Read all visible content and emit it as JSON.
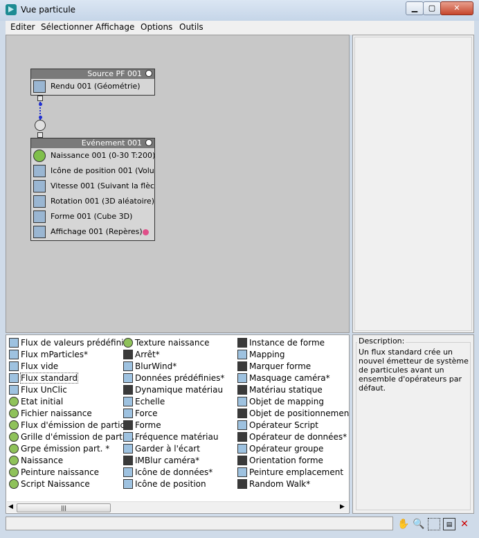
{
  "window": {
    "title": "Vue particule"
  },
  "menu": [
    "Editer",
    "Sélectionner",
    "Affichage",
    "Options",
    "Outils"
  ],
  "nodes": {
    "source": {
      "title": "Source PF 001",
      "rows": [
        {
          "label": "Rendu 001 (Géométrie)",
          "icon": "teapot-icon"
        }
      ]
    },
    "event": {
      "title": "Evénement 001",
      "rows": [
        {
          "label": "Naissance 001 (0-30 T:200)",
          "icon": "birth-icon"
        },
        {
          "label": "Icône de position 001 (Volu...",
          "icon": "position-icon"
        },
        {
          "label": "Vitesse 001 (Suivant la flèc...",
          "icon": "speed-icon"
        },
        {
          "label": "Rotation 001 (3D aléatoire)",
          "icon": "rotation-icon"
        },
        {
          "label": "Forme 001 (Cube 3D)",
          "icon": "shape-icon"
        },
        {
          "label": "Affichage 001 (Repères)",
          "icon": "display-icon"
        }
      ],
      "display_color": "#e0508a"
    }
  },
  "depot": {
    "col1": [
      "Flux de valeurs prédéfinies",
      "Flux mParticles*",
      "Flux vide",
      "Flux standard",
      "Flux UnClic",
      "Etat initial",
      "Fichier naissance",
      "Flux d'émission de partic...",
      "Grille d'émission de partic...",
      "Grpe émission part. *",
      "Naissance",
      "Peinture naissance",
      "Script Naissance"
    ],
    "col2": [
      "Texture naissance",
      "Arrêt*",
      "BlurWind*",
      "Données prédéfinies*",
      "Dynamique matériau",
      "Echelle",
      "Force",
      "Forme",
      "Fréquence matériau",
      "Garder à l'écart",
      "IMBlur caméra*",
      "Icône de données*",
      "Icône de position"
    ],
    "col3": [
      "Instance de forme",
      "Mapping",
      "Marquer forme",
      "Masquage caméra*",
      "Matériau statique",
      "Objet de mapping",
      "Objet de positionnement",
      "Opérateur Script",
      "Opérateur de données*",
      "Opérateur groupe",
      "Orientation forme",
      "Peinture emplacement",
      "Random Walk*"
    ],
    "selected": "Flux standard"
  },
  "description": {
    "label": "Description:",
    "text": "Un flux standard crée un nouvel émetteur de système de particules avant un ensemble d'opérateurs par défaut."
  },
  "toolbar": [
    "pan-hand-icon",
    "zoom-icon",
    "zoom-region-icon",
    "zoom-extents-icon",
    "no-zoom-icon"
  ]
}
